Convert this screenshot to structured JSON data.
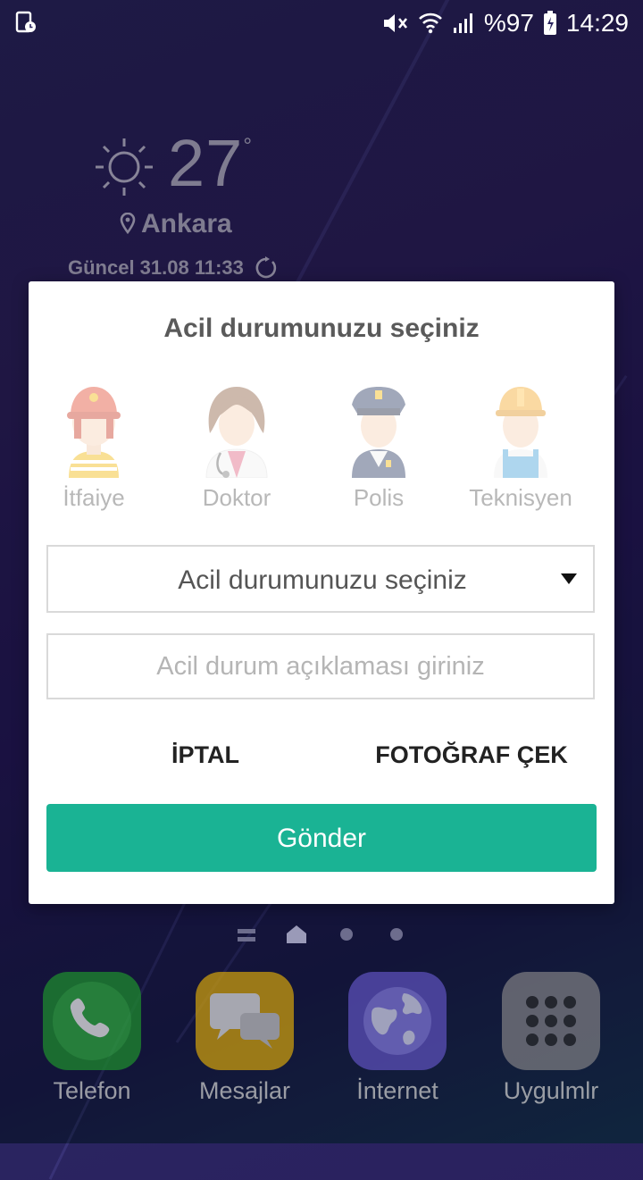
{
  "status_bar": {
    "battery": "%97",
    "time": "14:29"
  },
  "weather": {
    "temperature": "27",
    "degree": "°",
    "city": "Ankara",
    "updated": "Güncel 31.08 11:33"
  },
  "dialog": {
    "title": "Acil durumunuzu seçiniz",
    "roles": [
      {
        "label": "İtfaiye",
        "icon": "firefighter-icon"
      },
      {
        "label": "Doktor",
        "icon": "doctor-icon"
      },
      {
        "label": "Polis",
        "icon": "police-icon"
      },
      {
        "label": "Teknisyen",
        "icon": "technician-icon"
      }
    ],
    "select_value": "Acil durumunuzu seçiniz",
    "description_placeholder": "Acil durum açıklaması giriniz",
    "cancel_label": "İPTAL",
    "photo_label": "FOTOĞRAF ÇEK",
    "send_label": "Gönder",
    "accent_color": "#1ab394"
  },
  "dock": {
    "apps": [
      {
        "label": "Telefon",
        "icon": "phone-icon",
        "color": "#1e8a2e"
      },
      {
        "label": "Mesajlar",
        "icon": "messages-icon",
        "color": "#c99b0e"
      },
      {
        "label": "İnternet",
        "icon": "globe-icon",
        "color": "#5a4fb8"
      },
      {
        "label": "Uygulmlr",
        "icon": "apps-grid-icon",
        "color": "#7a7a80"
      }
    ]
  }
}
